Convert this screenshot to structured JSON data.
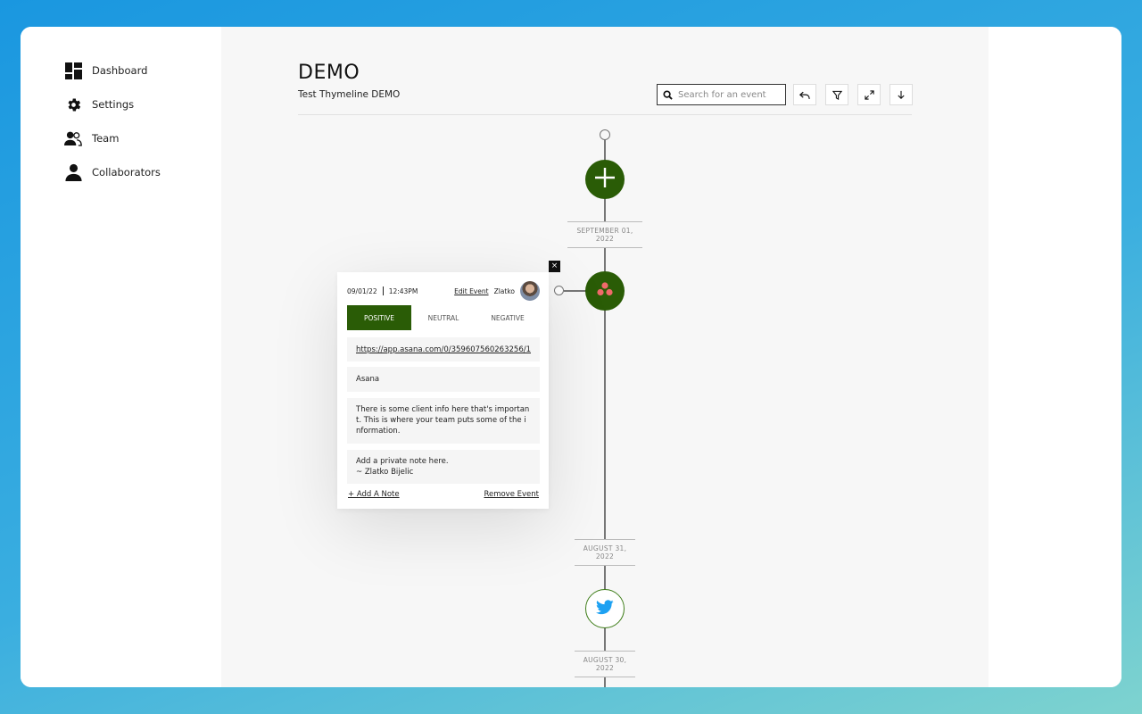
{
  "sidebar": {
    "items": [
      {
        "label": "Dashboard",
        "icon": "dashboard-icon"
      },
      {
        "label": "Settings",
        "icon": "gear-icon"
      },
      {
        "label": "Team",
        "icon": "team-icon"
      },
      {
        "label": "Collaborators",
        "icon": "person-icon"
      }
    ]
  },
  "header": {
    "title": "DEMO",
    "subtitle": "Test Thymeline DEMO",
    "search_placeholder": "Search for an event",
    "tools": [
      "undo-icon",
      "filter-icon",
      "expand-icon",
      "download-icon"
    ]
  },
  "timeline": {
    "dates": [
      "SEPTEMBER 01, 2022",
      "AUGUST 31, 2022",
      "AUGUST 30, 2022"
    ],
    "nodes": [
      {
        "icon": "plus-icon"
      },
      {
        "icon": "asana-icon"
      },
      {
        "icon": "twitter-icon"
      }
    ]
  },
  "event_card": {
    "date": "09/01/22",
    "time": "12:43PM",
    "edit_label": "Edit Event",
    "author": "Zlatko",
    "sentiment": {
      "options": [
        "POSITIVE",
        "NEUTRAL",
        "NEGATIVE"
      ],
      "selected": "POSITIVE"
    },
    "link": "https://app.asana.com/0/359607560263256/1",
    "source": "Asana",
    "description": "There is some client info here that's important. This is where your team puts some of the information.",
    "private_note_line1": "Add a private note here.",
    "private_note_line2": "~ Zlatko Bijelic",
    "add_note_label": "+ Add A Note",
    "remove_label": "Remove Event",
    "close_label": "×"
  },
  "colors": {
    "brand_green": "#2a5c06",
    "twitter_blue": "#1da1f2",
    "asana_coral": "#f06a6a"
  }
}
